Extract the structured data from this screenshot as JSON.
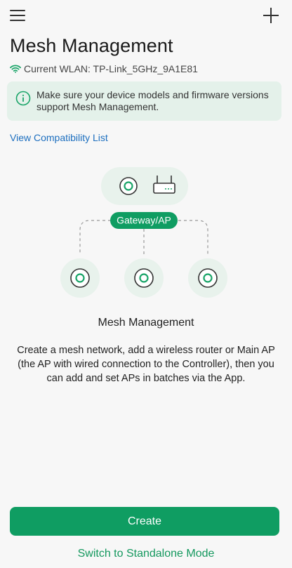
{
  "header": {
    "menu_icon": "hamburger-menu-icon",
    "add_icon": "plus-icon",
    "title": "Mesh Management"
  },
  "wlan": {
    "icon": "wifi-icon",
    "label": "Current WLAN: TP-Link_5GHz_9A1E81"
  },
  "notice": {
    "icon": "info-circle-icon",
    "text": "Make sure your device models and firmware versions support Mesh Management."
  },
  "compatibility_link": "View Compatibility List",
  "illustration": {
    "gateway_label": "Gateway/AP",
    "title": "Mesh Management",
    "description": "Create a mesh network, add a wireless router or Main AP (the AP with wired connection to the Controller), then you can add and set APs in batches via the App."
  },
  "actions": {
    "create_label": "Create",
    "standalone_label": "Switch to Standalone Mode"
  },
  "colors": {
    "accent": "#0f9d62",
    "link": "#1d6fbf",
    "notice_bg": "#e4f1ea"
  }
}
